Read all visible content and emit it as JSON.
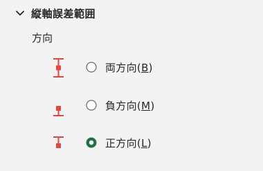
{
  "section": {
    "title": "縦軸誤差範囲",
    "expanded": true,
    "icon": "chevron-down-icon"
  },
  "direction_group": {
    "label": "方向",
    "options": [
      {
        "id": "both",
        "label": "両方向(B)",
        "text": "両方向(",
        "mnemonic": "B",
        "close": ")",
        "icon": "error-bar-both-icon",
        "selected": false
      },
      {
        "id": "minus",
        "label": "負方向(M)",
        "text": "負方向(",
        "mnemonic": "M",
        "close": ")",
        "icon": "error-bar-minus-icon",
        "selected": false
      },
      {
        "id": "plus",
        "label": "正方向(L)",
        "text": "正方向(",
        "mnemonic": "L",
        "close": ")",
        "icon": "error-bar-plus-icon",
        "selected": true
      }
    ]
  },
  "colors": {
    "error_bar": "#e8453c",
    "radio_selected": "#217346",
    "radio_unselected": "#6b6b6b",
    "background": "#f3f3f3",
    "text": "#262626"
  }
}
